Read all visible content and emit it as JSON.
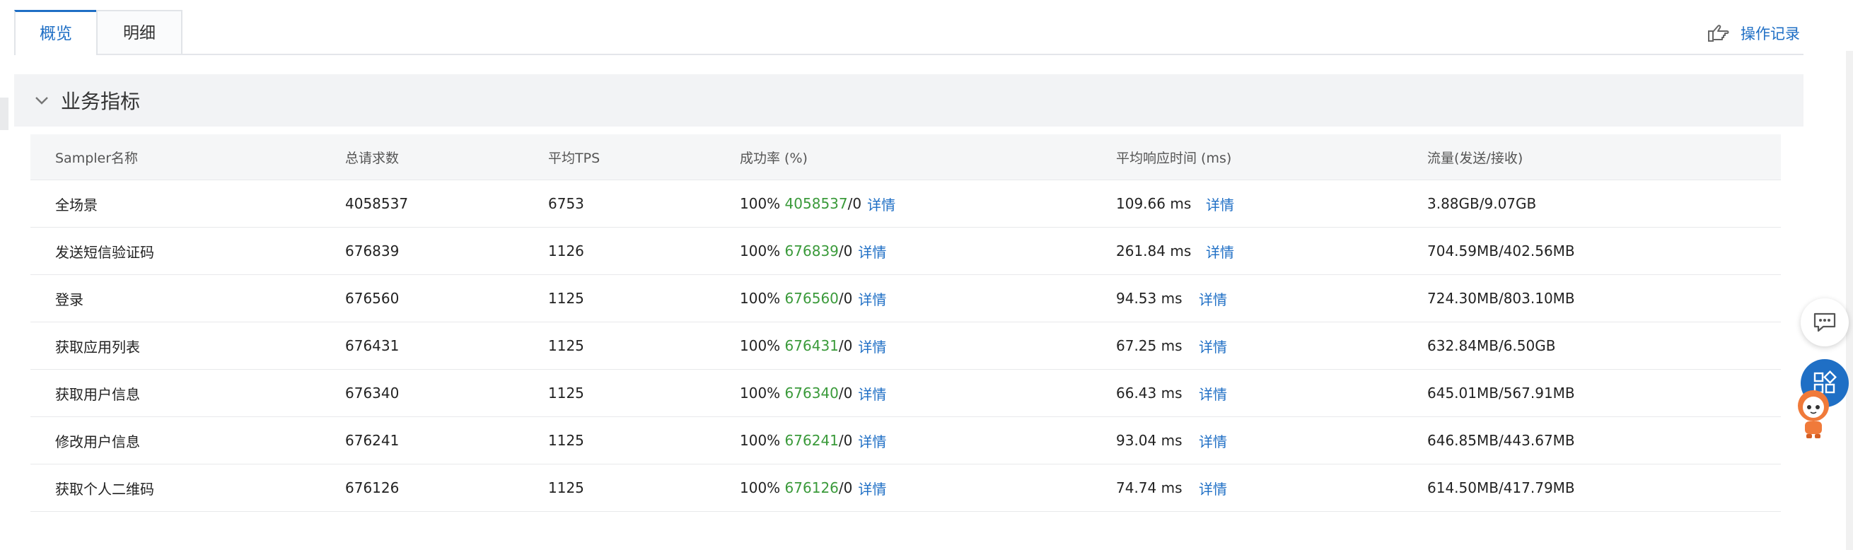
{
  "tabs": [
    {
      "label": "概览"
    },
    {
      "label": "明细"
    }
  ],
  "header": {
    "operation_log": "操作记录"
  },
  "section": {
    "title": "业务指标"
  },
  "table": {
    "columns": [
      "Sampler名称",
      "总请求数",
      "平均TPS",
      "成功率 (%)",
      "平均响应时间 (ms)",
      "流量(发送/接收)"
    ],
    "detail_label": "详情",
    "rows": [
      {
        "name": "全场景",
        "total": "4058537",
        "tps": "6753",
        "rate": "100%",
        "ok": "4058537",
        "fail": "/0",
        "rt": "109.66 ms",
        "traffic": "3.88GB/9.07GB"
      },
      {
        "name": "发送短信验证码",
        "total": "676839",
        "tps": "1126",
        "rate": "100%",
        "ok": "676839",
        "fail": "/0",
        "rt": "261.84 ms",
        "traffic": "704.59MB/402.56MB"
      },
      {
        "name": "登录",
        "total": "676560",
        "tps": "1125",
        "rate": "100%",
        "ok": "676560",
        "fail": "/0",
        "rt": "94.53 ms",
        "traffic": "724.30MB/803.10MB"
      },
      {
        "name": "获取应用列表",
        "total": "676431",
        "tps": "1125",
        "rate": "100%",
        "ok": "676431",
        "fail": "/0",
        "rt": "67.25 ms",
        "traffic": "632.84MB/6.50GB"
      },
      {
        "name": "获取用户信息",
        "total": "676340",
        "tps": "1125",
        "rate": "100%",
        "ok": "676340",
        "fail": "/0",
        "rt": "66.43 ms",
        "traffic": "645.01MB/567.91MB"
      },
      {
        "name": "修改用户信息",
        "total": "676241",
        "tps": "1125",
        "rate": "100%",
        "ok": "676241",
        "fail": "/0",
        "rt": "93.04 ms",
        "traffic": "646.85MB/443.67MB"
      },
      {
        "name": "获取个人二维码",
        "total": "676126",
        "tps": "1125",
        "rate": "100%",
        "ok": "676126",
        "fail": "/0",
        "rt": "74.74 ms",
        "traffic": "614.50MB/417.79MB"
      }
    ]
  },
  "icons": {
    "operation_log": "pointing-hand-icon",
    "section_toggle": "chevron-down-icon",
    "chat": "chat-bubble-icon",
    "apps": "apps-grid-icon",
    "mascot": "mascot-icon"
  },
  "colors": {
    "accent": "#1f6fc5",
    "success": "#3a9a3a",
    "header_bg": "#f2f3f5"
  }
}
